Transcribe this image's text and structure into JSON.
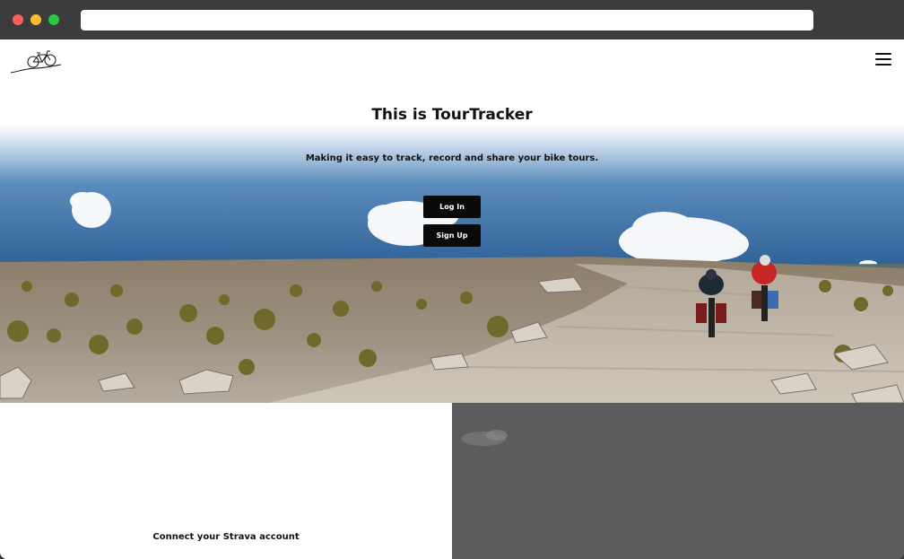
{
  "browser": {
    "address_value": ""
  },
  "navbar": {
    "logo_icon": "bicycle-logo-icon",
    "menu_icon": "hamburger-menu-icon"
  },
  "hero": {
    "title": "This is TourTracker",
    "subtitle": "Making it easy to track, record and share your bike tours.",
    "login_label": "Log In",
    "signup_label": "Sign Up"
  },
  "features": {
    "strava_caption": "Connect your Strava account"
  },
  "colors": {
    "button_bg": "#0a0a0a",
    "button_text": "#ffffff",
    "sky": "#2f6aa6",
    "gray_panel": "#5c5c5c"
  }
}
